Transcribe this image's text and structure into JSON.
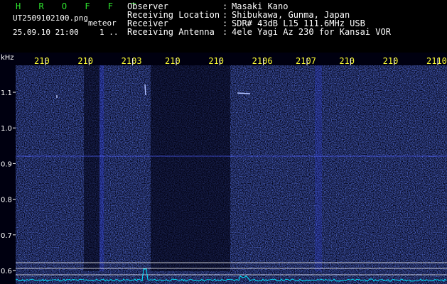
{
  "header": {
    "app_title": "H R O F F T",
    "file_name": "UT2509102100.png",
    "mode": "meteor",
    "datetime": "25.09.10 21:00",
    "page": "1 .."
  },
  "info": [
    {
      "label": "Observer",
      "sep": ":",
      "value": "Masaki Kano"
    },
    {
      "label": "Receiving Location",
      "sep": ":",
      "value": "Shibukawa, Gunma, Japan"
    },
    {
      "label": "Receiver",
      "sep": ":",
      "value": "SDR# 43dB L15 111.6MHz USB"
    },
    {
      "label": "Receiving Antenna",
      "sep": ":",
      "value": "4ele Yagi Az 230 for Kansai VOR"
    }
  ],
  "spectrogram": {
    "unit_label": "kHz",
    "time_ticks": [
      "210",
      "210",
      "2103",
      "210",
      "210",
      "2106",
      "2107",
      "210",
      "210",
      "2110"
    ],
    "freq_ticks": [
      {
        "label": "1.1",
        "value": 1.1
      },
      {
        "label": "1.0",
        "value": 1.0
      },
      {
        "label": "0.9",
        "value": 0.9
      },
      {
        "label": "0.8",
        "value": 0.8
      },
      {
        "label": "0.7",
        "value": 0.7
      },
      {
        "label": "0.6",
        "value": 0.6
      }
    ],
    "colors": {
      "background": "#000010",
      "noise": "#1c2fbf",
      "tick_text": "#ffff33",
      "axis_text": "#ffffff",
      "trace": "#00e5ff",
      "signal_line": "#5060ff"
    }
  }
}
